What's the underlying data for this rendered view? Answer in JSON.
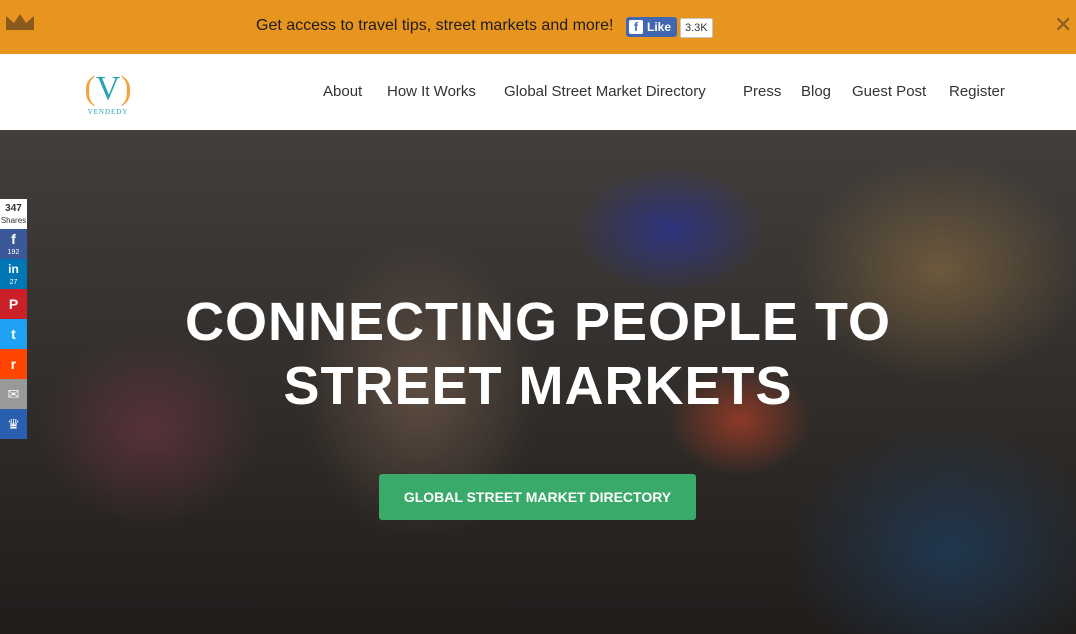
{
  "topbar": {
    "message": "Get access to travel tips, street markets and more!",
    "like_label": "Like",
    "like_count": "3.3K",
    "close_glyph": "✕",
    "crown_icon": "crown-icon",
    "bg_color": "#e8951f"
  },
  "brand": {
    "logo_letter": "V",
    "paren_left": "(",
    "paren_right": ")",
    "logo_word": "VENDEDY"
  },
  "nav": {
    "items": [
      "About",
      "How It Works",
      "Global Street Market Directory",
      "Press",
      "Blog",
      "Guest Post",
      "Register"
    ]
  },
  "hero": {
    "title_line1": "CONNECTING PEOPLE TO",
    "title_line2": "STREET MARKETS",
    "cta_label": "GLOBAL STREET MARKET DIRECTORY",
    "cta_color": "#3aaa6b"
  },
  "share": {
    "total": "347",
    "total_label": "Shares",
    "facebook_count": "192",
    "linkedin_count": "27",
    "buttons": [
      {
        "name": "facebook-icon",
        "glyph": "f",
        "color": "#3b5998"
      },
      {
        "name": "linkedin-icon",
        "glyph": "in",
        "color": "#0077b5"
      },
      {
        "name": "pinterest-icon",
        "glyph": "P",
        "color": "#cb2027"
      },
      {
        "name": "twitter-icon",
        "glyph": "t",
        "color": "#1da1f2"
      },
      {
        "name": "reddit-icon",
        "glyph": "r",
        "color": "#ff4500"
      },
      {
        "name": "email-icon",
        "glyph": "✉",
        "color": "#999999"
      },
      {
        "name": "sumo-icon",
        "glyph": "♛",
        "color": "#2a5fb0"
      }
    ]
  }
}
